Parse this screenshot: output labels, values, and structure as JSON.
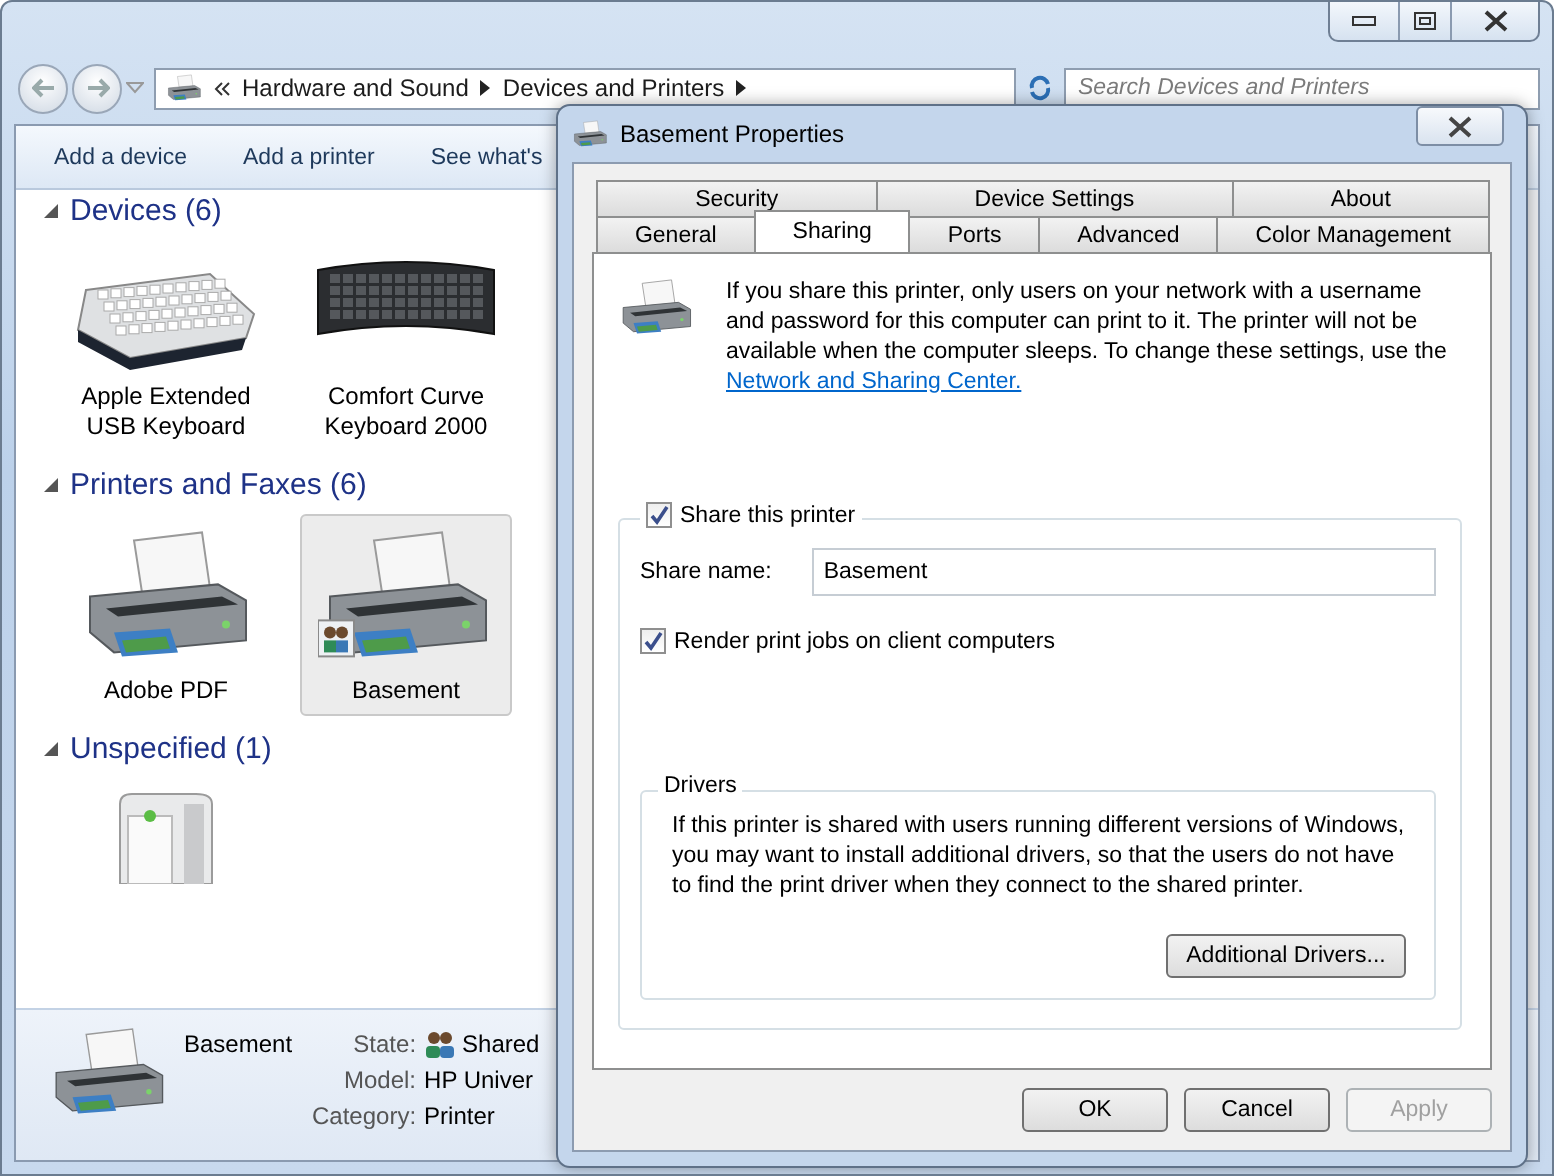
{
  "explorer": {
    "address": {
      "path": [
        "Hardware and Sound",
        "Devices and Printers"
      ]
    },
    "search": {
      "placeholder": "Search Devices and Printers"
    },
    "toolbar": [
      "Add a device",
      "Add a printer",
      "See what's"
    ],
    "groups": [
      {
        "title": "Devices (6)",
        "expanded": true,
        "items": [
          {
            "kind": "keyboard-light",
            "label": "Apple Extended USB Keyboard",
            "selected": false
          },
          {
            "kind": "keyboard-dark",
            "label": "Comfort Curve Keyboard 2000",
            "selected": false
          }
        ]
      },
      {
        "title": "Printers and Faxes (6)",
        "expanded": true,
        "items": [
          {
            "kind": "printer",
            "label": "Adobe PDF",
            "selected": false,
            "shared": false
          },
          {
            "kind": "printer",
            "label": "Basement",
            "selected": true,
            "shared": true
          }
        ]
      },
      {
        "title": "Unspecified (1)",
        "expanded": true,
        "items": [
          {
            "kind": "tower",
            "selected": false
          }
        ]
      }
    ],
    "details": {
      "name": "Basement",
      "fields": [
        {
          "label": "State:",
          "value": "Shared",
          "shared": true
        },
        {
          "label": "Model:",
          "value": "HP Univer",
          "shared": false
        },
        {
          "label": "Category:",
          "value": "Printer",
          "shared": false
        }
      ]
    }
  },
  "dialog": {
    "title": "Basement Properties",
    "tab_rows": [
      [
        {
          "label": "Security",
          "selected": false
        },
        {
          "label": "Device Settings",
          "selected": false
        },
        {
          "label": "About",
          "selected": false
        }
      ],
      [
        {
          "label": "General",
          "selected": false
        },
        {
          "label": "Sharing",
          "selected": true
        },
        {
          "label": "Ports",
          "selected": false
        },
        {
          "label": "Advanced",
          "selected": false
        },
        {
          "label": "Color Management",
          "selected": false
        }
      ]
    ],
    "intro": {
      "text": "If you share this printer, only users on your network with a username and password for this computer can print to it. The printer will not be available when the computer sleeps. To change these settings, use the",
      "link": "Network and Sharing Center."
    },
    "share": {
      "label": "Share this printer",
      "checked": true
    },
    "share_name": {
      "label": "Share name:",
      "value": "Basement"
    },
    "render": {
      "label": "Render print jobs on client computers",
      "checked": true
    },
    "drivers": {
      "title": "Drivers",
      "text": "If this printer is shared with users running different versions of Windows, you may want to install additional drivers, so that the users do not have to find the print driver when they connect to the shared printer.",
      "button": "Additional Drivers..."
    },
    "buttons": [
      {
        "label": "OK",
        "disabled": false
      },
      {
        "label": "Cancel",
        "disabled": false
      },
      {
        "label": "Apply",
        "disabled": true
      }
    ]
  }
}
